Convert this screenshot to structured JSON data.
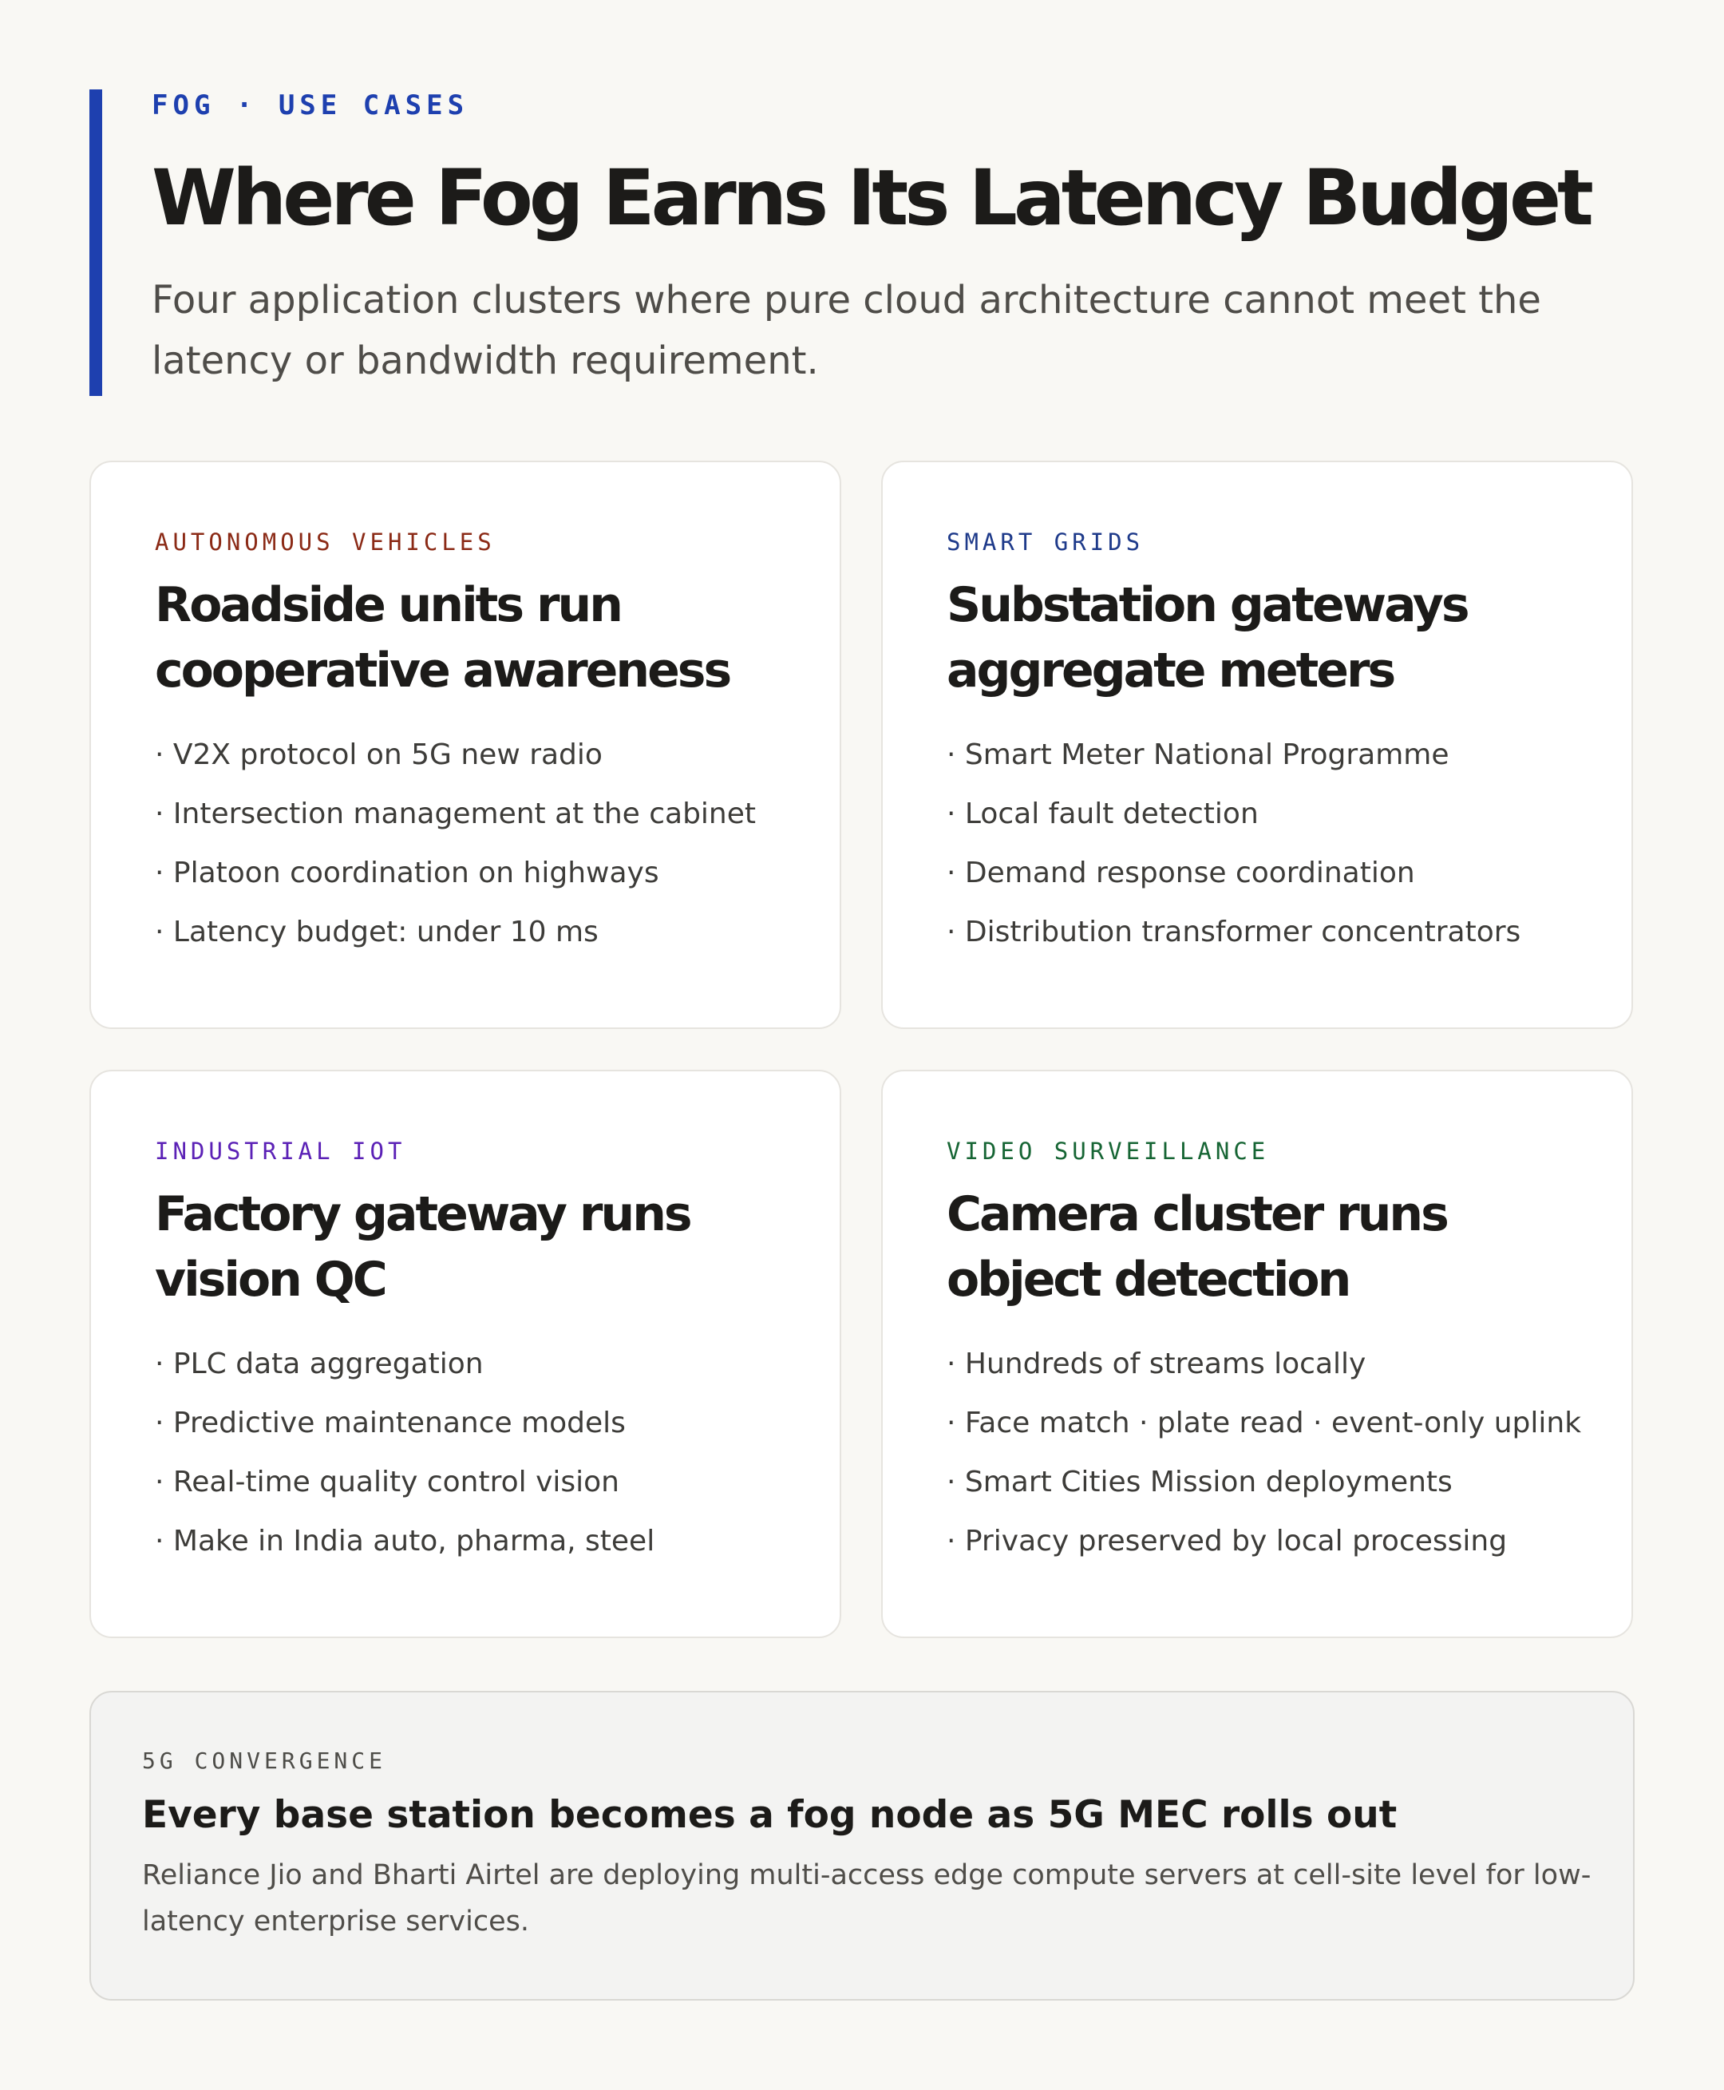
{
  "header": {
    "eyebrow": "FOG · USE CASES",
    "title": "Where Fog Earns Its Latency Budget",
    "subtitle": "Four application clusters where pure cloud architecture cannot meet the latency or bandwidth requirement.",
    "accent_color": "#1e40af"
  },
  "cards": [
    {
      "label": "AUTONOMOUS VEHICLES",
      "label_color": "#8b2a16",
      "heading": "Roadside units run cooperative awareness",
      "items": [
        "V2X protocol on 5G new radio",
        "Intersection management at the cabinet",
        "Platoon coordination on highways",
        "Latency budget: under 10 ms"
      ]
    },
    {
      "label": "SMART GRIDS",
      "label_color": "#1e3a8a",
      "heading": "Substation gateways aggregate meters",
      "items": [
        "Smart Meter National Programme",
        "Local fault detection",
        "Demand response coordination",
        "Distribution transformer concentrators"
      ]
    },
    {
      "label": "INDUSTRIAL IOT",
      "label_color": "#5b21b6",
      "heading": "Factory gateway runs vision QC",
      "items": [
        "PLC data aggregation",
        "Predictive maintenance models",
        "Real-time quality control vision",
        "Make in India auto, pharma, steel"
      ]
    },
    {
      "label": "VIDEO SURVEILLANCE",
      "label_color": "#166534",
      "heading": "Camera cluster runs object detection",
      "items": [
        "Hundreds of streams locally",
        "Face match · plate read · event-only uplink",
        "Smart Cities Mission deployments",
        "Privacy preserved by local processing"
      ]
    }
  ],
  "callout": {
    "label": "5G CONVERGENCE",
    "title": "Every base station becomes a fog node as 5G MEC rolls out",
    "body": "Reliance Jio and Bharti Airtel are deploying multi-access edge compute servers at cell-site level for low-latency enterprise services."
  }
}
